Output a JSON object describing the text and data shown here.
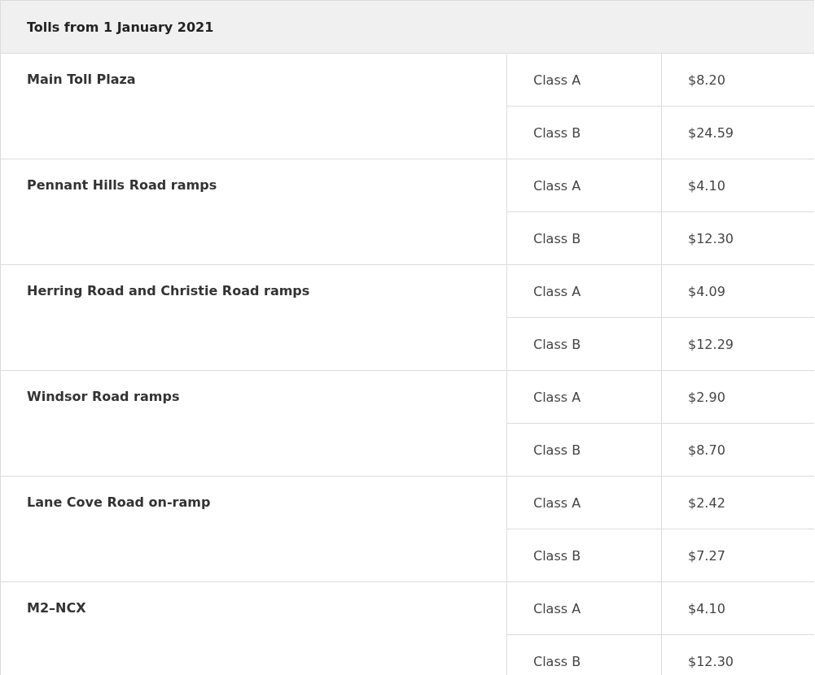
{
  "table": {
    "title": "Tolls from 1 January 2021",
    "rows": [
      {
        "location": "Main Toll Plaza",
        "tolls": [
          {
            "class": "Class A",
            "price": "$8.20"
          },
          {
            "class": "Class B",
            "price": "$24.59"
          }
        ]
      },
      {
        "location": "Pennant Hills Road ramps",
        "tolls": [
          {
            "class": "Class A",
            "price": "$4.10"
          },
          {
            "class": "Class B",
            "price": "$12.30"
          }
        ]
      },
      {
        "location": "Herring Road and Christie Road ramps",
        "tolls": [
          {
            "class": "Class A",
            "price": "$4.09"
          },
          {
            "class": "Class B",
            "price": "$12.29"
          }
        ]
      },
      {
        "location": "Windsor Road ramps",
        "tolls": [
          {
            "class": "Class A",
            "price": "$2.90"
          },
          {
            "class": "Class B",
            "price": "$8.70"
          }
        ]
      },
      {
        "location": "Lane Cove Road on-ramp",
        "tolls": [
          {
            "class": "Class A",
            "price": "$2.42"
          },
          {
            "class": "Class B",
            "price": "$7.27"
          }
        ]
      },
      {
        "location": "M2–NCX",
        "tolls": [
          {
            "class": "Class A",
            "price": "$4.10"
          },
          {
            "class": "Class B",
            "price": "$12.30"
          }
        ]
      }
    ]
  }
}
